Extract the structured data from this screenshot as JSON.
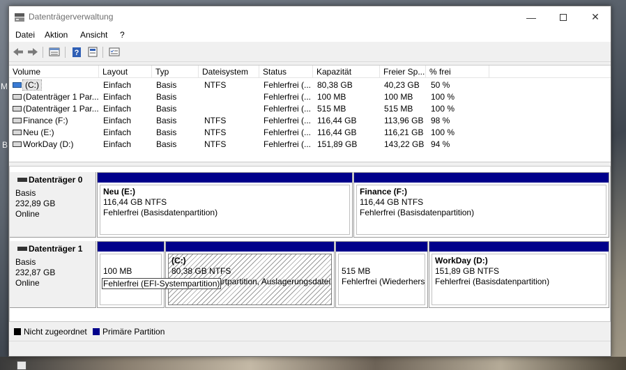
{
  "window": {
    "title": "Datenträgerverwaltung"
  },
  "menu": [
    "Datei",
    "Aktion",
    "Ansicht",
    "?"
  ],
  "toolbar_icons": [
    "back-arrow-icon",
    "forward-arrow-icon",
    "volume-list-icon",
    "help-icon",
    "properties-icon",
    "checklist-icon"
  ],
  "desktop": {
    "letter_m": "M",
    "letter_b": "B"
  },
  "volumes": {
    "columns": [
      "Volume",
      "Layout",
      "Typ",
      "Dateisystem",
      "Status",
      "Kapazität",
      "Freier Sp...",
      "% frei"
    ],
    "rows": [
      [
        "(C:)",
        "Einfach",
        "Basis",
        "NTFS",
        "Fehlerfrei (...",
        "80,38 GB",
        "40,23 GB",
        "50 %"
      ],
      [
        "(Datenträger 1 Par...",
        "Einfach",
        "Basis",
        "",
        "Fehlerfrei (...",
        "100 MB",
        "100 MB",
        "100 %"
      ],
      [
        "(Datenträger 1 Par...",
        "Einfach",
        "Basis",
        "",
        "Fehlerfrei (...",
        "515 MB",
        "515 MB",
        "100 %"
      ],
      [
        "Finance (F:)",
        "Einfach",
        "Basis",
        "NTFS",
        "Fehlerfrei (...",
        "116,44 GB",
        "113,96 GB",
        "98 %"
      ],
      [
        "Neu (E:)",
        "Einfach",
        "Basis",
        "NTFS",
        "Fehlerfrei (...",
        "116,44 GB",
        "116,21 GB",
        "100 %"
      ],
      [
        "WorkDay (D:)",
        "Einfach",
        "Basis",
        "NTFS",
        "Fehlerfrei (...",
        "151,89 GB",
        "143,22 GB",
        "94 %"
      ]
    ]
  },
  "disks": [
    {
      "name": "Datenträger 0",
      "type": "Basis",
      "size": "232,89 GB",
      "state": "Online",
      "partitions": [
        {
          "title": "Neu  (E:)",
          "line1": "116,44 GB NTFS",
          "line2": "Fehlerfrei (Basisdatenpartition)"
        },
        {
          "title": "Finance  (F:)",
          "line1": "116,44 GB NTFS",
          "line2": "Fehlerfrei (Basisdatenpartition)"
        }
      ]
    },
    {
      "name": "Datenträger 1",
      "type": "Basis",
      "size": "232,87 GB",
      "state": "Online",
      "partitions": [
        {
          "title": "",
          "line1": "100 MB",
          "line2": "Fehlerfrei (EFI-Systempartition)"
        },
        {
          "title": "(C:)",
          "line1": "80,38 GB NTFS",
          "line2": "artpartition, Auslagerungsdatei"
        },
        {
          "title": "",
          "line1": "515 MB",
          "line2": "Fehlerfrei (Wiederherst"
        },
        {
          "title": "WorkDay  (D:)",
          "line1": "151,89 GB NTFS",
          "line2": "Fehlerfrei (Basisdatenpartition)"
        }
      ]
    }
  ],
  "legend": [
    {
      "label": "Nicht zugeordnet",
      "color": "#000000"
    },
    {
      "label": "Primäre Partition",
      "color": "#00008b"
    }
  ]
}
